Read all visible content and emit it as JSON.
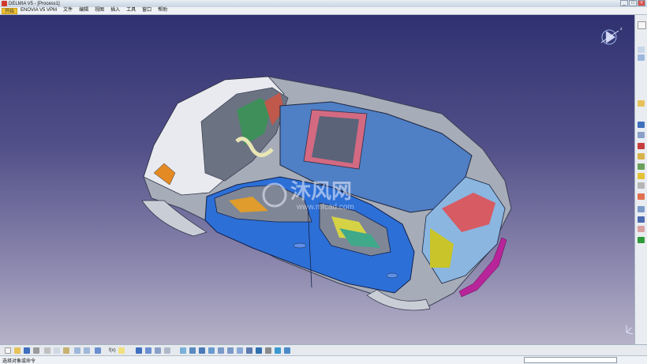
{
  "window": {
    "title": "DELMIA V5 - [Process1]"
  },
  "menubar": {
    "start": "开始",
    "items": [
      "ENOVIA V5 VPM",
      "文件",
      "编辑",
      "视图",
      "插入",
      "工具",
      "窗口",
      "帮助"
    ]
  },
  "viewport": {
    "watermark": "沐风网",
    "watermark_url": "www.mfcad.com"
  },
  "statusbar": {
    "prompt": "选择对象或命令"
  },
  "colors": {
    "background_top": "#2f3170",
    "background_bottom": "#b6b2c8",
    "body_blue": "#2c6fd6",
    "roof_blue": "#4f7fc5",
    "accent_yellow": "#c8c42a",
    "accent_magenta": "#b8249a"
  },
  "icons": {
    "right_toolbar": [
      "cursor-icon",
      "sketch-icon",
      "part-icon",
      "assembly-icon",
      "manufacture-icon",
      "resource-icon",
      "process-icon",
      "tree-icon",
      "analysis-icon",
      "compass-icon",
      "measure-icon",
      "simulation-icon",
      "plan-icon",
      "graph-icon",
      "check-icon"
    ],
    "bottom_toolbar": [
      "new-icon",
      "open-icon",
      "save-icon",
      "print-icon",
      "cut-icon",
      "copy-icon",
      "paste-icon",
      "undo-icon",
      "redo-icon",
      "help-icon",
      "formula-icon",
      "comment-icon",
      "select-icon",
      "move-icon",
      "rotate-icon",
      "snap-icon",
      "fly-icon",
      "fit-all-icon",
      "pan-icon",
      "rotate-view-icon",
      "zoom-in-icon",
      "zoom-out-icon",
      "normal-view-icon",
      "iso-view-icon",
      "render-icon",
      "hide-show-icon",
      "swap-icon",
      "catalog-icon",
      "analysis-icon"
    ]
  }
}
